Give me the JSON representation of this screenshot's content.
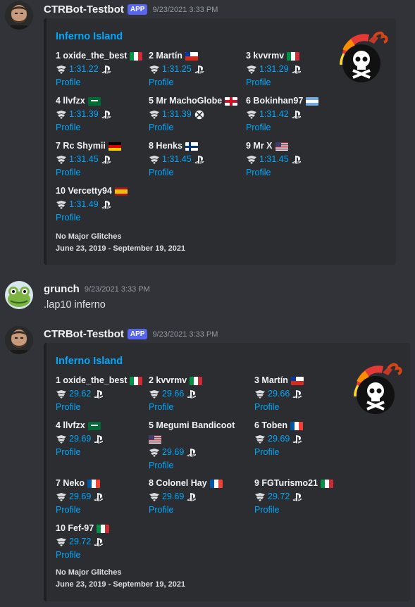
{
  "messages": [
    {
      "author": "CTRBot-Testbot",
      "tag": "APP",
      "timestamp": "9/23/2021 3:33 PM",
      "embed": {
        "title": "Inferno Island",
        "footer_line1": "No Major Glitches",
        "footer_line2": "June 23, 2019 - September 19, 2021",
        "entries": [
          {
            "name": "1 oxide_the_best",
            "flag": "it",
            "time": "1:31.22",
            "platform": "ps",
            "profile": "Profile"
          },
          {
            "name": "2 Martín",
            "flag": "cl",
            "time": "1:31.25",
            "platform": "ps",
            "profile": "Profile"
          },
          {
            "name": "3 kvvrmv",
            "flag": "it",
            "time": "1:31.29",
            "platform": "ps",
            "profile": "Profile"
          },
          {
            "name": "4 llvfzx",
            "flag": "sa",
            "time": "1:31.39",
            "platform": "ps",
            "profile": "Profile"
          },
          {
            "name": "5 Mr MachoGlobe",
            "flag": "en",
            "time": "1:31.39",
            "platform": "xbox",
            "profile": "Profile"
          },
          {
            "name": "6 Bokinhan97",
            "flag": "ar",
            "time": "1:31.42",
            "platform": "ps",
            "profile": "Profile"
          },
          {
            "name": "7 Rc Shymii",
            "flag": "de",
            "time": "1:31.45",
            "platform": "ps",
            "profile": "Profile"
          },
          {
            "name": "8 Henks",
            "flag": "fi",
            "time": "1:31.45",
            "platform": "ps",
            "profile": "Profile"
          },
          {
            "name": "9 Mr X",
            "flag": "us",
            "time": "1:31.45",
            "platform": "ps",
            "profile": "Profile"
          },
          {
            "name": "10 Vercetty94",
            "flag": "es",
            "time": "1:31.49",
            "platform": "ps",
            "profile": "Profile"
          }
        ]
      }
    },
    {
      "author": "grunch",
      "timestamp": "9/23/2021 3:33 PM",
      "text": ".lap10 inferno"
    },
    {
      "author": "CTRBot-Testbot",
      "tag": "APP",
      "timestamp": "9/23/2021 3:33 PM",
      "embed": {
        "title": "Inferno Island",
        "footer_line1": "No Major Glitches",
        "footer_line2": "June 23, 2019 - September 19, 2021",
        "entries": [
          {
            "name": "1 oxide_the_best",
            "flag": "it",
            "time": "29.62",
            "platform": "ps",
            "profile": "Profile"
          },
          {
            "name": "2 kvvrmv",
            "flag": "it",
            "time": "29.66",
            "platform": "ps",
            "profile": "Profile"
          },
          {
            "name": "3 Martín",
            "flag": "cl",
            "time": "29.66",
            "platform": "ps",
            "profile": "Profile"
          },
          {
            "name": "4 llvfzx",
            "flag": "sa",
            "time": "29.69",
            "platform": "ps",
            "profile": "Profile"
          },
          {
            "name": "5 Megumi Bandicoot",
            "flag": "us",
            "time": "29.69",
            "platform": "ps",
            "profile": "Profile",
            "flag_wrap": true
          },
          {
            "name": "6 Toben",
            "flag": "fr",
            "time": "29.69",
            "platform": "ps",
            "profile": "Profile"
          },
          {
            "name": "7 Neko",
            "flag": "fr",
            "time": "29.69",
            "platform": "ps",
            "profile": "Profile"
          },
          {
            "name": "8 Colonel Hay",
            "flag": "fr",
            "time": "29.69",
            "platform": "ps",
            "profile": "Profile"
          },
          {
            "name": "9 FGTurismo21",
            "flag": "it",
            "time": "29.72",
            "platform": "ps",
            "profile": "Profile"
          },
          {
            "name": "10 Fef-97",
            "flag": "it",
            "time": "29.72",
            "platform": "ps",
            "profile": "Profile"
          }
        ]
      }
    }
  ],
  "colors": {
    "background": "#313338",
    "embed": "#2b2d31",
    "link": "#00a8fc",
    "app_tag": "#5865f2"
  },
  "icons": {
    "wheel": "steering-wheel-icon",
    "ps": "playstation-icon",
    "xbox": "xbox-icon",
    "thumbnail": "bomb-icon"
  }
}
